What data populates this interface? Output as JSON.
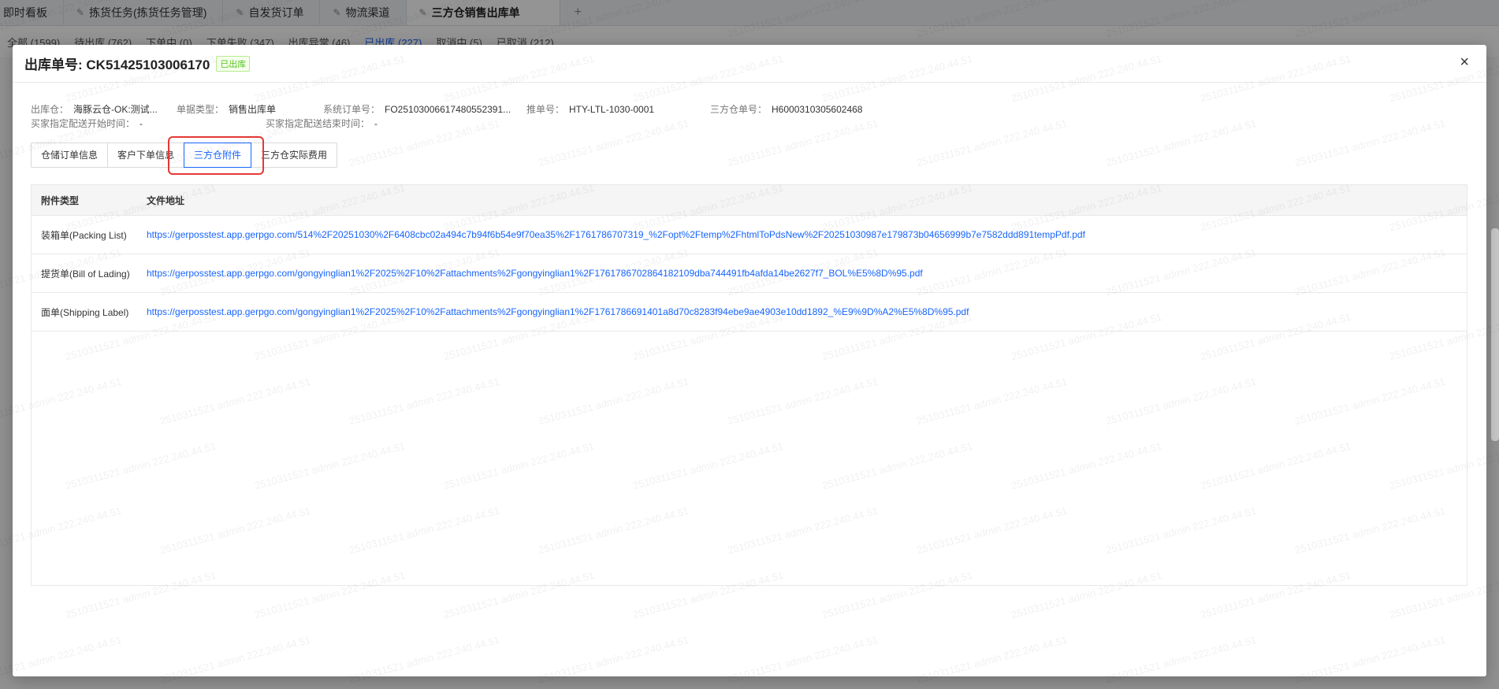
{
  "tabs": [
    {
      "label": "即时看板",
      "pinned": false,
      "active": false
    },
    {
      "label": "拣货任务(拣货任务管理)",
      "pinned": true,
      "active": false
    },
    {
      "label": "自发货订单",
      "pinned": true,
      "active": false
    },
    {
      "label": "物流渠道",
      "pinned": true,
      "active": false
    },
    {
      "label": "三方仓销售出库单",
      "pinned": true,
      "active": true
    }
  ],
  "tab_add_label": "+",
  "filters": [
    {
      "label": "全部 (1599)",
      "active": false
    },
    {
      "label": "待出库 (762)",
      "active": false
    },
    {
      "label": "下单中 (0)",
      "active": false
    },
    {
      "label": "下单失败 (347)",
      "active": false
    },
    {
      "label": "出库异常 (46)",
      "active": false
    },
    {
      "label": "已出库 (227)",
      "active": true
    },
    {
      "label": "取消中 (5)",
      "active": false
    },
    {
      "label": "已取消 (212)",
      "active": false
    }
  ],
  "modal": {
    "title": "出库单号: CK51425103006170",
    "status": "已出库",
    "close_label": "×",
    "info": {
      "warehouse_label": "出库仓：",
      "warehouse_value": "海豚云仓-OK:测试...",
      "doc_type_label": "单据类型：",
      "doc_type_value": "销售出库单",
      "sys_order_label": "系统订单号：",
      "sys_order_value": "FO25103006617480552391...",
      "push_order_label": "推单号：",
      "push_order_value": "HTY-LTL-1030-0001",
      "third_order_label": "三方仓单号：",
      "third_order_value": "H6000310305602468",
      "start_time_label": "买家指定配送开始时间：",
      "start_time_value": "-",
      "end_time_label": "买家指定配送结束时间：",
      "end_time_value": "-"
    },
    "buttons": [
      {
        "label": "仓储订单信息",
        "active": false
      },
      {
        "label": "客户下单信息",
        "active": false
      },
      {
        "label": "三方仓附件",
        "active": true
      },
      {
        "label": "三方仓实际费用",
        "active": false
      }
    ],
    "table": {
      "headers": [
        "附件类型",
        "文件地址"
      ],
      "rows": [
        {
          "type": "装箱单(Packing List)",
          "url": "https://gerposstest.app.gerpgo.com/514%2F20251030%2F6408cbc02a494c7b94f6b54e9f70ea35%2F1761786707319_%2Fopt%2Ftemp%2FhtmlToPdsNew%2F20251030987e179873b04656999b7e7582ddd891tempPdf.pdf"
        },
        {
          "type": "提货单(Bill of Lading)",
          "url": "https://gerposstest.app.gerpgo.com/gongyinglian1%2F2025%2F10%2Fattachments%2Fgongyinglian1%2F1761786702864182109dba744491fb4afda14be2627f7_BOL%E5%8D%95.pdf"
        },
        {
          "type": "面单(Shipping Label)",
          "url": "https://gerposstest.app.gerpgo.com/gongyinglian1%2F2025%2F10%2Fattachments%2Fgongyinglian1%2F1761786691401a8d70c8283f94ebe9ae4903e10dd1892_%E9%9D%A2%E5%8D%95.pdf"
        }
      ]
    }
  },
  "watermark_text": "2510311521 admin 222.240.44.51"
}
